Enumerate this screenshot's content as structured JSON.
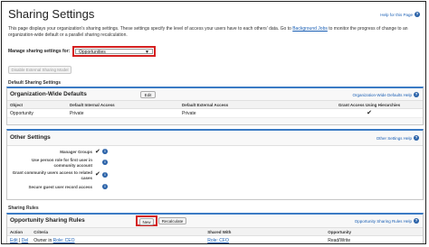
{
  "page": {
    "title": "Sharing Settings",
    "help_link": "Help for this Page",
    "description_before": "This page displays your organization's sharing settings. These settings specify the level of access your users have to each others' data. Go to ",
    "description_link": "Background Jobs",
    "description_after": " to monitor the progress of change to an organization-wide default or a parallel sharing recalculation."
  },
  "manage": {
    "label": "Manage sharing settings for:",
    "selected": "Opportunities",
    "arrow": "▼"
  },
  "disabled_button": "Disable External Sharing Model",
  "defaults_section": {
    "label": "Default Sharing Settings",
    "title": "Organization-Wide Defaults",
    "edit_label": "Edit",
    "help_link": "Organization-Wide Defaults Help",
    "columns": [
      "Object",
      "Default Internal Access",
      "Default External Access",
      "Grant Access Using Hierarchies"
    ],
    "rows": [
      {
        "object": "Opportunity",
        "internal": "Private",
        "external": "Private",
        "grant": "✔"
      }
    ]
  },
  "other_settings": {
    "title": "Other Settings",
    "help_link": "Other Settings Help",
    "items": [
      {
        "label": "Manager Groups",
        "value": "✔"
      },
      {
        "label": "Use person role for first user in community account",
        "value": ""
      },
      {
        "label": "Grant community users access to related cases",
        "value": "✔"
      },
      {
        "label": "Secure guest user record access",
        "value": ""
      }
    ]
  },
  "rules_section": {
    "label": "Sharing Rules",
    "title": "Opportunity Sharing Rules",
    "new_label": "New",
    "recalc_label": "Recalculate",
    "help_link": "Opportunity Sharing Rules Help",
    "columns": [
      "Action",
      "Criteria",
      "Shared With",
      "Opportunity"
    ],
    "rows": [
      {
        "edit": "Edit",
        "sep": " | ",
        "del": "Del",
        "criteria_prefix": "Owner in ",
        "criteria_link": "Role: CEO",
        "shared": "Role: CFO",
        "access": "Read/Write"
      }
    ]
  },
  "icons": {
    "help": "help-icon",
    "info": "info-icon",
    "check": "checkmark-icon",
    "dropdown": "chevron-down-icon"
  },
  "colors": {
    "accent_blue": "#3b7bc4",
    "link": "#1a5fb4",
    "highlight_red": "#d42020"
  }
}
